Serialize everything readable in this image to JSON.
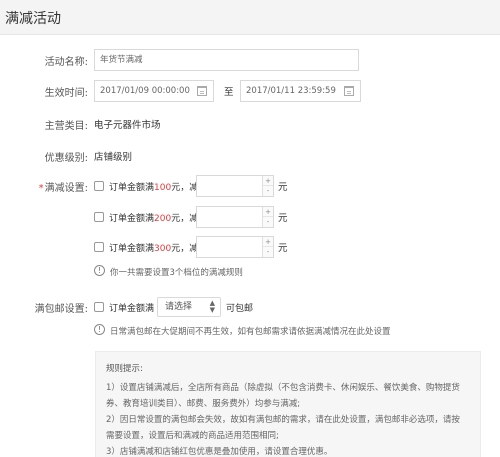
{
  "header": {
    "title": "满减活动"
  },
  "activity_name": {
    "label": "活动名称:",
    "value": "年货节满减"
  },
  "effective_time": {
    "label": "生效时间:",
    "start": "2017/01/09 00:00:00",
    "separator": "至",
    "end": "2017/01/11 23:59:59"
  },
  "category": {
    "label": "主营类目:",
    "value": "电子元器件市场"
  },
  "level": {
    "label": "优惠级别:",
    "value": "店铺级别"
  },
  "discount": {
    "required_mark": "*",
    "label": "满减设置:",
    "rules": [
      {
        "prefix": "订单金额满",
        "amount": "100",
        "suffix": "元，减",
        "unit": "元"
      },
      {
        "prefix": "订单金额满",
        "amount": "200",
        "suffix": "元，减",
        "unit": "元"
      },
      {
        "prefix": "订单金额满",
        "amount": "300",
        "suffix": "元，减",
        "unit": "元"
      }
    ],
    "note": "你一共需要设置3个档位的满减规则"
  },
  "free_shipping": {
    "label": "满包邮设置:",
    "prefix": "订单金额满",
    "select_value": "请选择",
    "suffix": "可包邮",
    "note": "日常满包邮在大促期间不再生效，如有包邮需求请依据满减情况在此处设置"
  },
  "tips": {
    "title": "规则提示:",
    "lines": [
      "1）设置店铺满减后，全店所有商品（除虚拟（不包含消费卡、休闲娱乐、餐饮美食、购物提货",
      "券、教育培训类目）、邮费、服务费外）均参与满减;",
      "2）因日常设置的满包邮会失效，故如有满包邮的需求，请在此处设置，满包邮非必选项，请按",
      "需要设置，设置后和满减的商品适用范围相同;",
      "3）店铺满减和店铺红包优惠是叠加使用，请设置合理优惠。"
    ]
  }
}
